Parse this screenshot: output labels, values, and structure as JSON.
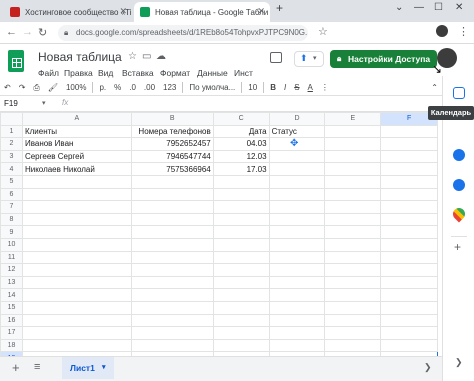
{
  "browser": {
    "tabs": [
      {
        "label": "Хостинговое сообщество «Tim",
        "favicon_color": "#c5221f"
      },
      {
        "label": "Новая таблица - Google Табли",
        "favicon_color": "#0f9d58"
      }
    ],
    "new_tab": "+",
    "url": "docs.google.com/spreadsheets/d/1REb8o54TohpvxPJTPC9N0G..."
  },
  "doc": {
    "title": "Новая таблица",
    "menu": [
      "Файл",
      "Правка",
      "Вид",
      "Вставка",
      "Формат",
      "Данные",
      "Инст"
    ],
    "share_label": "Настройки Доступа"
  },
  "toolbar": {
    "zoom": "100%",
    "currency": "р.",
    "percent": "%",
    "dec_less": ".0",
    "dec_more": ".00",
    "format_123": "123",
    "font": "По умолча...",
    "font_size": "10",
    "bold": "B",
    "italic": "I",
    "strike": "S",
    "text_color": "A"
  },
  "formula": {
    "cell_ref": "F19",
    "fx": "fx"
  },
  "grid": {
    "columns": [
      "A",
      "B",
      "C",
      "D",
      "E",
      "F"
    ],
    "rows": [
      [
        "1",
        "Клиенты",
        "Номера телефонов",
        "Дата",
        "Статус",
        "",
        ""
      ],
      [
        "2",
        "Иванов Иван",
        "7952652457",
        "04.03",
        "",
        "",
        ""
      ],
      [
        "3",
        "Сергеев Сергей",
        "7946547744",
        "12.03",
        "",
        "",
        ""
      ],
      [
        "4",
        "Николаев Николай",
        "7575366964",
        "17.03",
        "",
        "",
        ""
      ],
      [
        "5",
        "",
        "",
        "",
        "",
        "",
        ""
      ],
      [
        "6",
        "",
        "",
        "",
        "",
        "",
        ""
      ],
      [
        "7",
        "",
        "",
        "",
        "",
        "",
        ""
      ],
      [
        "8",
        "",
        "",
        "",
        "",
        "",
        ""
      ],
      [
        "9",
        "",
        "",
        "",
        "",
        "",
        ""
      ],
      [
        "10",
        "",
        "",
        "",
        "",
        "",
        ""
      ],
      [
        "11",
        "",
        "",
        "",
        "",
        "",
        ""
      ],
      [
        "12",
        "",
        "",
        "",
        "",
        "",
        ""
      ],
      [
        "13",
        "",
        "",
        "",
        "",
        "",
        ""
      ],
      [
        "14",
        "",
        "",
        "",
        "",
        "",
        ""
      ],
      [
        "15",
        "",
        "",
        "",
        "",
        "",
        ""
      ],
      [
        "16",
        "",
        "",
        "",
        "",
        "",
        ""
      ],
      [
        "17",
        "",
        "",
        "",
        "",
        "",
        ""
      ],
      [
        "18",
        "",
        "",
        "",
        "",
        "",
        ""
      ],
      [
        "19",
        "",
        "",
        "",
        "",
        "",
        ""
      ],
      [
        "20",
        "",
        "",
        "",
        "",
        "",
        ""
      ]
    ]
  },
  "sheets": {
    "add": "+",
    "list": "≡",
    "active_sheet": "Лист1"
  },
  "side": {
    "tooltip": "Календарь",
    "icons": [
      "calendar-icon",
      "tasks-icon",
      "contacts-icon",
      "maps-icon"
    ]
  },
  "colors": {
    "share": "#188038",
    "selection": "#1a73e8",
    "sheet_tab_text": "#0b57d0"
  }
}
